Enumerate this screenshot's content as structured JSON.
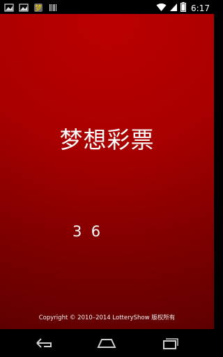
{
  "status_bar": {
    "time": "6:17",
    "notification_icons": [
      "image-icon",
      "image-icon",
      "app-notification-icon",
      "barcode-icon"
    ],
    "system_icons": [
      "wifi-icon",
      "signal-icon",
      "battery-icon"
    ]
  },
  "splash": {
    "title": "梦想彩票",
    "version": "3  6",
    "copyright": "Copyright © 2010–2014 LotteryShow 版权所有"
  },
  "nav_bar": {
    "buttons": [
      "back-icon",
      "home-icon",
      "recent-apps-icon"
    ]
  }
}
